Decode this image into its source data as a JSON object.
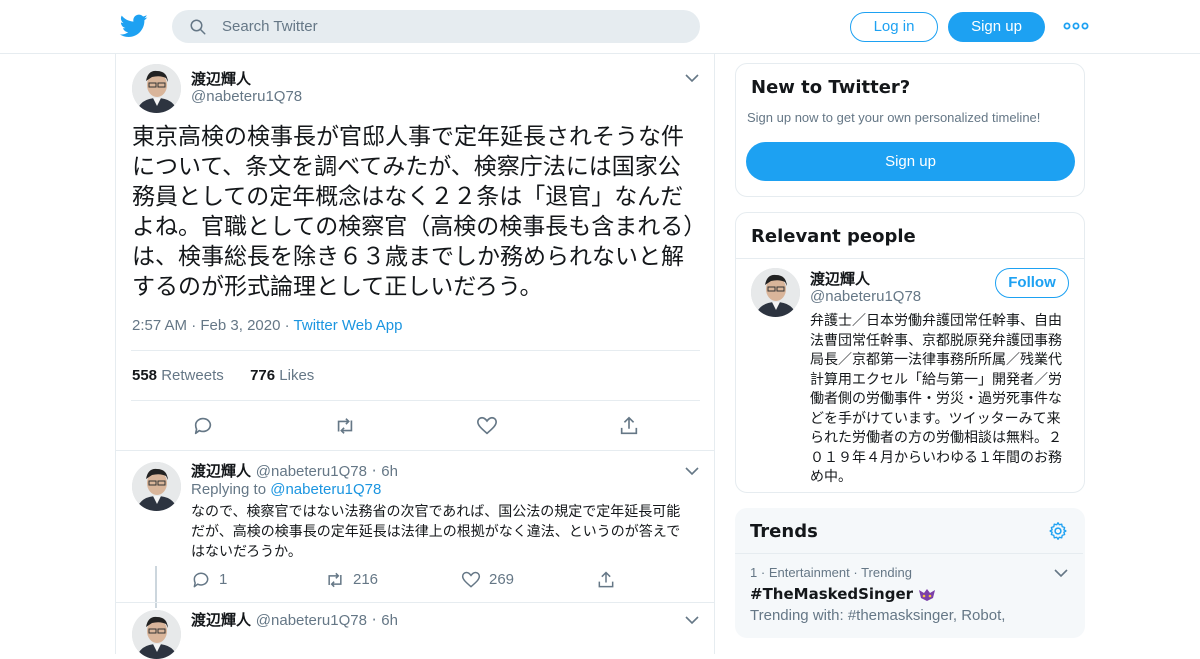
{
  "header": {
    "search_placeholder": "Search Twitter",
    "login_label": "Log in",
    "signup_label": "Sign up"
  },
  "main_tweet": {
    "author_name": "渡辺輝人",
    "author_handle": "@nabeteru1Q78",
    "text": "東京高検の検事長が官邸人事で定年延長されそうな件について、条文を調べてみたが、検察庁法には国家公務員としての定年概念はなく２２条は「退官」なんだよね。官職としての検察官（高検の検事長も含まれる）は、検事総長を除き６３歳までしか務められないと解するのが形式論理として正しいだろう。",
    "time": "2:57 AM",
    "date": "Feb 3, 2020",
    "source": "Twitter Web App",
    "retweets_count": "558",
    "retweets_label": "Retweets",
    "likes_count": "776",
    "likes_label": "Likes"
  },
  "reply_1": {
    "author_name": "渡辺輝人",
    "author_handle": "@nabeteru1Q78",
    "age": "6h",
    "replying_to_label": "Replying to",
    "replying_to_handle": "@nabeteru1Q78",
    "text": "なので、検察官ではない法務省の次官であれば、国公法の規定で定年延長可能だが、高検の検事長の定年延長は法律上の根拠がなく違法、というのが答えではないだろうか。",
    "replies": "1",
    "retweets": "216",
    "likes": "269"
  },
  "reply_2": {
    "author_name": "渡辺輝人",
    "author_handle": "@nabeteru1Q78",
    "age": "6h"
  },
  "sidebar": {
    "new_title": "New to Twitter?",
    "new_subtitle": "Sign up now to get your own personalized timeline!",
    "new_signup": "Sign up",
    "relevant_title": "Relevant people",
    "person_name": "渡辺輝人",
    "person_handle": "@nabeteru1Q78",
    "follow_label": "Follow",
    "person_bio": "弁護士／日本労働弁護団常任幹事、自由法曹団常任幹事、京都脱原発弁護団事務局長／京都第一法律事務所所属／残業代計算用エクセル「給与第一」開発者／労働者側の労働事件・労災・過労死事件などを手がけています。ツイッターみて来られた労働者の方の労働相談は無料。２０１９年４月からいわゆる１年間のお務め中。",
    "trends_title": "Trends",
    "trend_rank": "1",
    "trend_category": "Entertainment",
    "trend_status": "Trending",
    "trend_name": "#TheMaskedSinger",
    "trend_with": "Trending with: #themasksinger, Robot,"
  },
  "colors": {
    "twitter_blue": "#1da1f2",
    "link_blue": "#1b95e0",
    "muted": "#657786",
    "border": "#e6ecf0"
  }
}
